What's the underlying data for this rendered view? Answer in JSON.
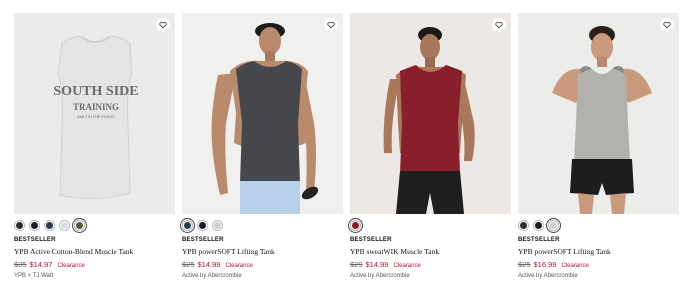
{
  "colors": {
    "sale": "#c8102e",
    "image_bg_1": "#ebebeb",
    "image_bg_2": "#f0f0ee",
    "image_bg_3": "#ece8e6",
    "image_bg_4": "#ececea"
  },
  "products": [
    {
      "image_icon": "sleeveless-tee-product-image",
      "graphic_text": [
        "SOUTH SIDE",
        "TRAINING",
        "BUILT IN THE STUDIO"
      ],
      "swatches": [
        "#2b2b2b",
        "#1c1f2b",
        "#303a4a",
        "#d9dde8",
        "#4d5a3a"
      ],
      "selected_swatch": 4,
      "badge": "BESTSELLER",
      "name": "YPB Active Cotton-Blend Muscle Tank",
      "original_price": "$35",
      "sale_price": "$14.97",
      "clearance": "Clearance",
      "brand": "YPB × TJ Watt"
    },
    {
      "image_icon": "charcoal-tank-model-image",
      "swatches": [
        "#2d3a52",
        "#1a1d28",
        "#cfcfcf"
      ],
      "selected_swatch": 0,
      "badge": "BESTSELLER",
      "name": "YPB powerSOFT Lifting Tank",
      "original_price": "$25",
      "sale_price": "$14.99",
      "clearance": "Clearance",
      "brand": "Active by Abercrombie"
    },
    {
      "image_icon": "burgundy-tank-model-image",
      "swatches": [
        "#8c1a2b"
      ],
      "selected_swatch": 0,
      "badge": "BESTSELLER",
      "name": "YPB sweatWIK Muscle Tank",
      "original_price": "$29",
      "sale_price": "$14.99",
      "clearance": "Clearance",
      "brand": "Active by Abercrombie"
    },
    {
      "image_icon": "grey-tank-model-image",
      "swatches": [
        "#2a2d35",
        "#1b1d26",
        "#c9ccd2"
      ],
      "selected_swatch": 2,
      "badge": "BESTSELLER",
      "name": "YPB powerSOFT Lifting Tank",
      "original_price": "$25",
      "sale_price": "$16.99",
      "clearance": "Clearance",
      "brand": "Active by Abercrombie"
    }
  ]
}
